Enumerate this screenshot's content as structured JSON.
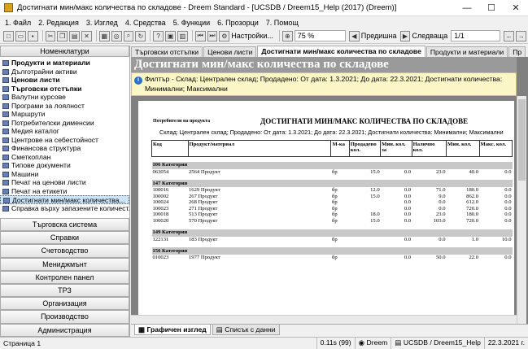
{
  "window": {
    "title": "Достигнати мин/макс количества по складове - Dreem Standard - [UCSDB / Dreem15_Help (2017) (Dreem)]",
    "minimize": "—",
    "maximize": "☐",
    "close": "✕"
  },
  "menu": [
    "1. Файл",
    "2. Редакция",
    "3. Изглед",
    "4. Средства",
    "5. Функции",
    "6. Прозорци",
    "7. Помощ"
  ],
  "toolbar": {
    "settings_label": "Настройки...",
    "zoom_value": "75 %",
    "prev_label": "Предишна",
    "next_label": "Следваща",
    "page_value": "1/1"
  },
  "left": {
    "header": "Номенклатури",
    "items": [
      {
        "label": "Продукти и материали",
        "bold": true
      },
      {
        "label": "Дълготрайни активи",
        "bold": false
      },
      {
        "label": "Ценови листи",
        "bold": true
      },
      {
        "label": "Търговски отстъпки",
        "bold": true
      },
      {
        "label": "Валутни курсове",
        "bold": false
      },
      {
        "label": "Програми за лоялност",
        "bold": false
      },
      {
        "label": "Маршрути",
        "bold": false
      },
      {
        "label": "Потребителски дименсии",
        "bold": false
      },
      {
        "label": "Медия каталог",
        "bold": false
      },
      {
        "label": "Центрове на себестойност",
        "bold": false
      },
      {
        "label": "Финансова структура",
        "bold": false
      },
      {
        "label": "Сметкоплан",
        "bold": false
      },
      {
        "label": "Типове документи",
        "bold": false
      },
      {
        "label": "Машини",
        "bold": false
      },
      {
        "label": "Печат на ценови листи",
        "bold": false
      },
      {
        "label": "Печат на етикети",
        "bold": false
      },
      {
        "label": "Достигнати мин/макс количества...",
        "bold": false,
        "selected": true
      },
      {
        "label": "Справка върху запазените количест...",
        "bold": false
      }
    ],
    "nav": [
      "Търговска система",
      "Справки",
      "Счетоводство",
      "Мениджмънт",
      "Контролен панел",
      "ТРЗ",
      "Организация",
      "Производство",
      "Администрация"
    ]
  },
  "tabs": [
    "Търговски отстъпки",
    "Ценови листи",
    "Достигнати мин/макс количества по складове",
    "Продукти и материали",
    "Пр"
  ],
  "report": {
    "big_title": "Достигнати мин/макс количества по складове",
    "filter": "Филтър - Склад: Централен склад; Продадено: От дата: 1.3.2021; До дата: 22.3.2021; Достигнати количества: Минимални; Максимални",
    "small_left": "Потребители на продукта",
    "title": "ДОСТИГНАТИ МИН/МАКС КОЛИЧЕСТВА ПО СКЛАДОВЕ",
    "subtitle": "Склад: Централен склад; Продадено: От дата: 1.3.2021; До дата: 22.3.2021; Достигнати количества: Минимални; Максимални",
    "columns": [
      "Код",
      "Продукт/материал",
      "М-ка",
      "Продадено кол.",
      "Мин. кол. за",
      "Налично кол.",
      "Мин. кол.",
      "Макс. кол."
    ],
    "groups": [
      {
        "name": "106 Категория",
        "rows": [
          [
            "063054",
            "2564 Продукт",
            "бр",
            "15.0",
            "0.0",
            "23.0",
            "40.0",
            "0.0"
          ]
        ]
      },
      {
        "name": "147 Категория",
        "rows": [
          [
            "100016",
            "1629 Продукт",
            "бр",
            "12.0",
            "0.0",
            "71.0",
            "180.0",
            "0.0"
          ],
          [
            "100002",
            "267 Продукт",
            "бр",
            "15.0",
            "0.0",
            "9.0",
            "862.0",
            "0.0"
          ],
          [
            "100024",
            "268 Продукт",
            "бр",
            "",
            "0.0",
            "0.0",
            "612.0",
            "0.0"
          ],
          [
            "100023",
            "271 Продукт",
            "бр",
            "",
            "0.0",
            "0.0",
            "720.0",
            "0.0"
          ],
          [
            "100018",
            "513 Продукт",
            "бр",
            "18.0",
            "0.0",
            "23.0",
            "180.0",
            "0.0"
          ],
          [
            "100020",
            "570 Продукт",
            "бр",
            "15.0",
            "0.0",
            "103.0",
            "720.0",
            "0.0"
          ]
        ]
      },
      {
        "name": "149 Категория",
        "rows": [
          [
            "122131",
            "183 Продукт",
            "бр",
            "",
            "0.0",
            "0.0",
            "1.0",
            "10.0"
          ]
        ]
      },
      {
        "name": "156 Категория",
        "rows": [
          [
            "010023",
            "1977 Продукт",
            "бр",
            "",
            "0.0",
            "50.0",
            "22.0",
            "0.0"
          ]
        ]
      }
    ]
  },
  "bottom_tabs": [
    "Графичен изглед",
    "Списък с данни"
  ],
  "status": {
    "page": "Страница 1",
    "time": "0.11s (99)",
    "user": "Dreem",
    "db": "UCSDB / Dreem15_Help",
    "date": "22.3.2021 г."
  }
}
